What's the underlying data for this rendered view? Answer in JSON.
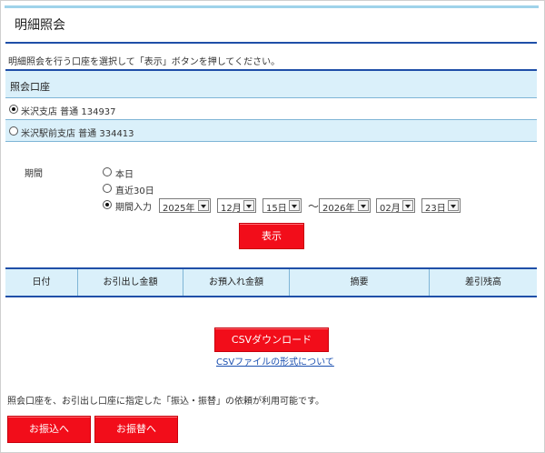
{
  "page": {
    "title": "明細照会",
    "instruction": "明細照会を行う口座を選択して「表示」ボタンを押してください。"
  },
  "accounts": {
    "header": "照会口座",
    "items": [
      {
        "label": "米沢支店 普通 134937",
        "selected": true
      },
      {
        "label": "米沢駅前支店 普通 334413",
        "selected": false
      }
    ]
  },
  "period": {
    "label": "期間",
    "options": [
      {
        "label": "本日",
        "selected": false
      },
      {
        "label": "直近30日",
        "selected": false
      },
      {
        "label": "期間入力",
        "selected": true
      }
    ],
    "from": {
      "year": "2025年",
      "month": "12月",
      "day": "15日"
    },
    "separator": "～",
    "to": {
      "year": "2026年",
      "month": "02月",
      "day": "23日"
    }
  },
  "buttons": {
    "show": "表示",
    "csv_download": "CSVダウンロード",
    "transfer": "お振込へ",
    "fund_transfer": "お振替へ"
  },
  "table": {
    "columns": [
      "日付",
      "お引出し金額",
      "お預入れ金額",
      "摘要",
      "差引残高"
    ]
  },
  "links": {
    "csv_format": "CSVファイルの形式について"
  },
  "notice": "照会口座を、お引出し口座に指定した「振込・振替」の依頼が利用可能です。",
  "colors": {
    "accent_blue": "#1f4fa8",
    "header_bg": "#daf0fa",
    "button_red": "#f20d1a",
    "link": "#1a4fb0"
  }
}
